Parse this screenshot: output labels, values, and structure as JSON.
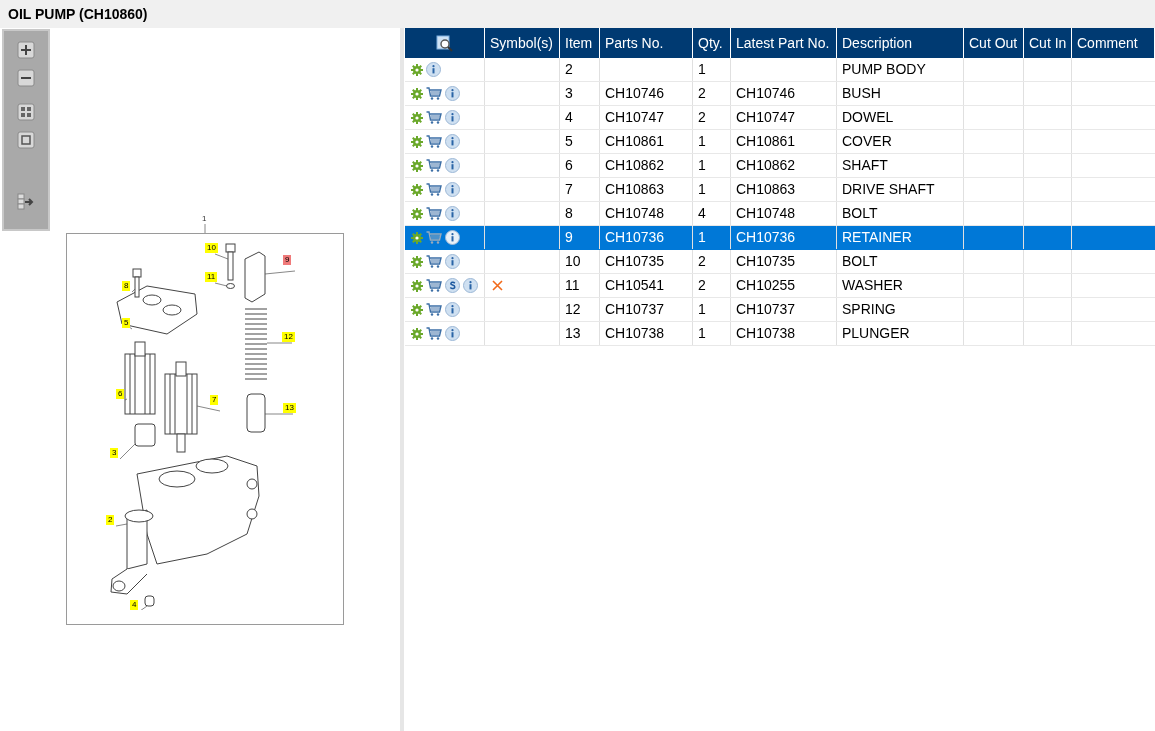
{
  "title": "OIL PUMP (CH10860)",
  "toolbar": [
    {
      "kind": "zoom-in"
    },
    {
      "kind": "zoom-out"
    },
    {
      "kind": "grid"
    },
    {
      "kind": "fit"
    },
    {
      "kind": "export"
    }
  ],
  "diagram": {
    "sheet_label": "1",
    "callouts": [
      {
        "label": "10",
        "selected": false
      },
      {
        "label": "9",
        "selected": true
      },
      {
        "label": "11",
        "selected": false
      },
      {
        "label": "8",
        "selected": false
      },
      {
        "label": "5",
        "selected": false
      },
      {
        "label": "12",
        "selected": false
      },
      {
        "label": "6",
        "selected": false
      },
      {
        "label": "7",
        "selected": false
      },
      {
        "label": "13",
        "selected": false
      },
      {
        "label": "3",
        "selected": false
      },
      {
        "label": "2",
        "selected": false
      },
      {
        "label": "4",
        "selected": false
      }
    ]
  },
  "table": {
    "columns": [
      "Symbol(s)",
      "Item",
      "Parts No.",
      "Qty.",
      "Latest Part No.",
      "Description",
      "Cut Out",
      "Cut In",
      "Comment"
    ],
    "rows": [
      {
        "icons": [
          {
            "kind": "gear"
          },
          {
            "kind": "info"
          }
        ],
        "cross": false,
        "item": "2",
        "parts_no": "",
        "qty": "1",
        "latest": "",
        "description": "PUMP BODY",
        "selected": false
      },
      {
        "icons": [
          {
            "kind": "gear"
          },
          {
            "kind": "cart"
          },
          {
            "kind": "info"
          }
        ],
        "cross": false,
        "item": "3",
        "parts_no": "CH10746",
        "qty": "2",
        "latest": "CH10746",
        "description": "BUSH",
        "selected": false
      },
      {
        "icons": [
          {
            "kind": "gear"
          },
          {
            "kind": "cart"
          },
          {
            "kind": "info"
          }
        ],
        "cross": false,
        "item": "4",
        "parts_no": "CH10747",
        "qty": "2",
        "latest": "CH10747",
        "description": "DOWEL",
        "selected": false
      },
      {
        "icons": [
          {
            "kind": "gear"
          },
          {
            "kind": "cart"
          },
          {
            "kind": "info"
          }
        ],
        "cross": false,
        "item": "5",
        "parts_no": "CH10861",
        "qty": "1",
        "latest": "CH10861",
        "description": "COVER",
        "selected": false
      },
      {
        "icons": [
          {
            "kind": "gear"
          },
          {
            "kind": "cart"
          },
          {
            "kind": "info"
          }
        ],
        "cross": false,
        "item": "6",
        "parts_no": "CH10862",
        "qty": "1",
        "latest": "CH10862",
        "description": "SHAFT",
        "selected": false
      },
      {
        "icons": [
          {
            "kind": "gear"
          },
          {
            "kind": "cart"
          },
          {
            "kind": "info"
          }
        ],
        "cross": false,
        "item": "7",
        "parts_no": "CH10863",
        "qty": "1",
        "latest": "CH10863",
        "description": "DRIVE SHAFT",
        "selected": false
      },
      {
        "icons": [
          {
            "kind": "gear"
          },
          {
            "kind": "cart"
          },
          {
            "kind": "info"
          }
        ],
        "cross": false,
        "item": "8",
        "parts_no": "CH10748",
        "qty": "4",
        "latest": "CH10748",
        "description": "BOLT",
        "selected": false
      },
      {
        "icons": [
          {
            "kind": "gear"
          },
          {
            "kind": "cart"
          },
          {
            "kind": "info"
          }
        ],
        "cross": false,
        "item": "9",
        "parts_no": "CH10736",
        "qty": "1",
        "latest": "CH10736",
        "description": "RETAINER",
        "selected": true
      },
      {
        "icons": [
          {
            "kind": "gear"
          },
          {
            "kind": "cart"
          },
          {
            "kind": "info"
          }
        ],
        "cross": false,
        "item": "10",
        "parts_no": "CH10735",
        "qty": "2",
        "latest": "CH10735",
        "description": "BOLT",
        "selected": false
      },
      {
        "icons": [
          {
            "kind": "gear"
          },
          {
            "kind": "cart"
          },
          {
            "kind": "s"
          },
          {
            "kind": "info"
          }
        ],
        "cross": true,
        "item": "11",
        "parts_no": "CH10541",
        "qty": "2",
        "latest": "CH10255",
        "description": "WASHER",
        "selected": false
      },
      {
        "icons": [
          {
            "kind": "gear"
          },
          {
            "kind": "cart"
          },
          {
            "kind": "info"
          }
        ],
        "cross": false,
        "item": "12",
        "parts_no": "CH10737",
        "qty": "1",
        "latest": "CH10737",
        "description": "SPRING",
        "selected": false
      },
      {
        "icons": [
          {
            "kind": "gear"
          },
          {
            "kind": "cart"
          },
          {
            "kind": "info"
          }
        ],
        "cross": false,
        "item": "13",
        "parts_no": "CH10738",
        "qty": "1",
        "latest": "CH10738",
        "description": "PLUNGER",
        "selected": false
      }
    ]
  }
}
